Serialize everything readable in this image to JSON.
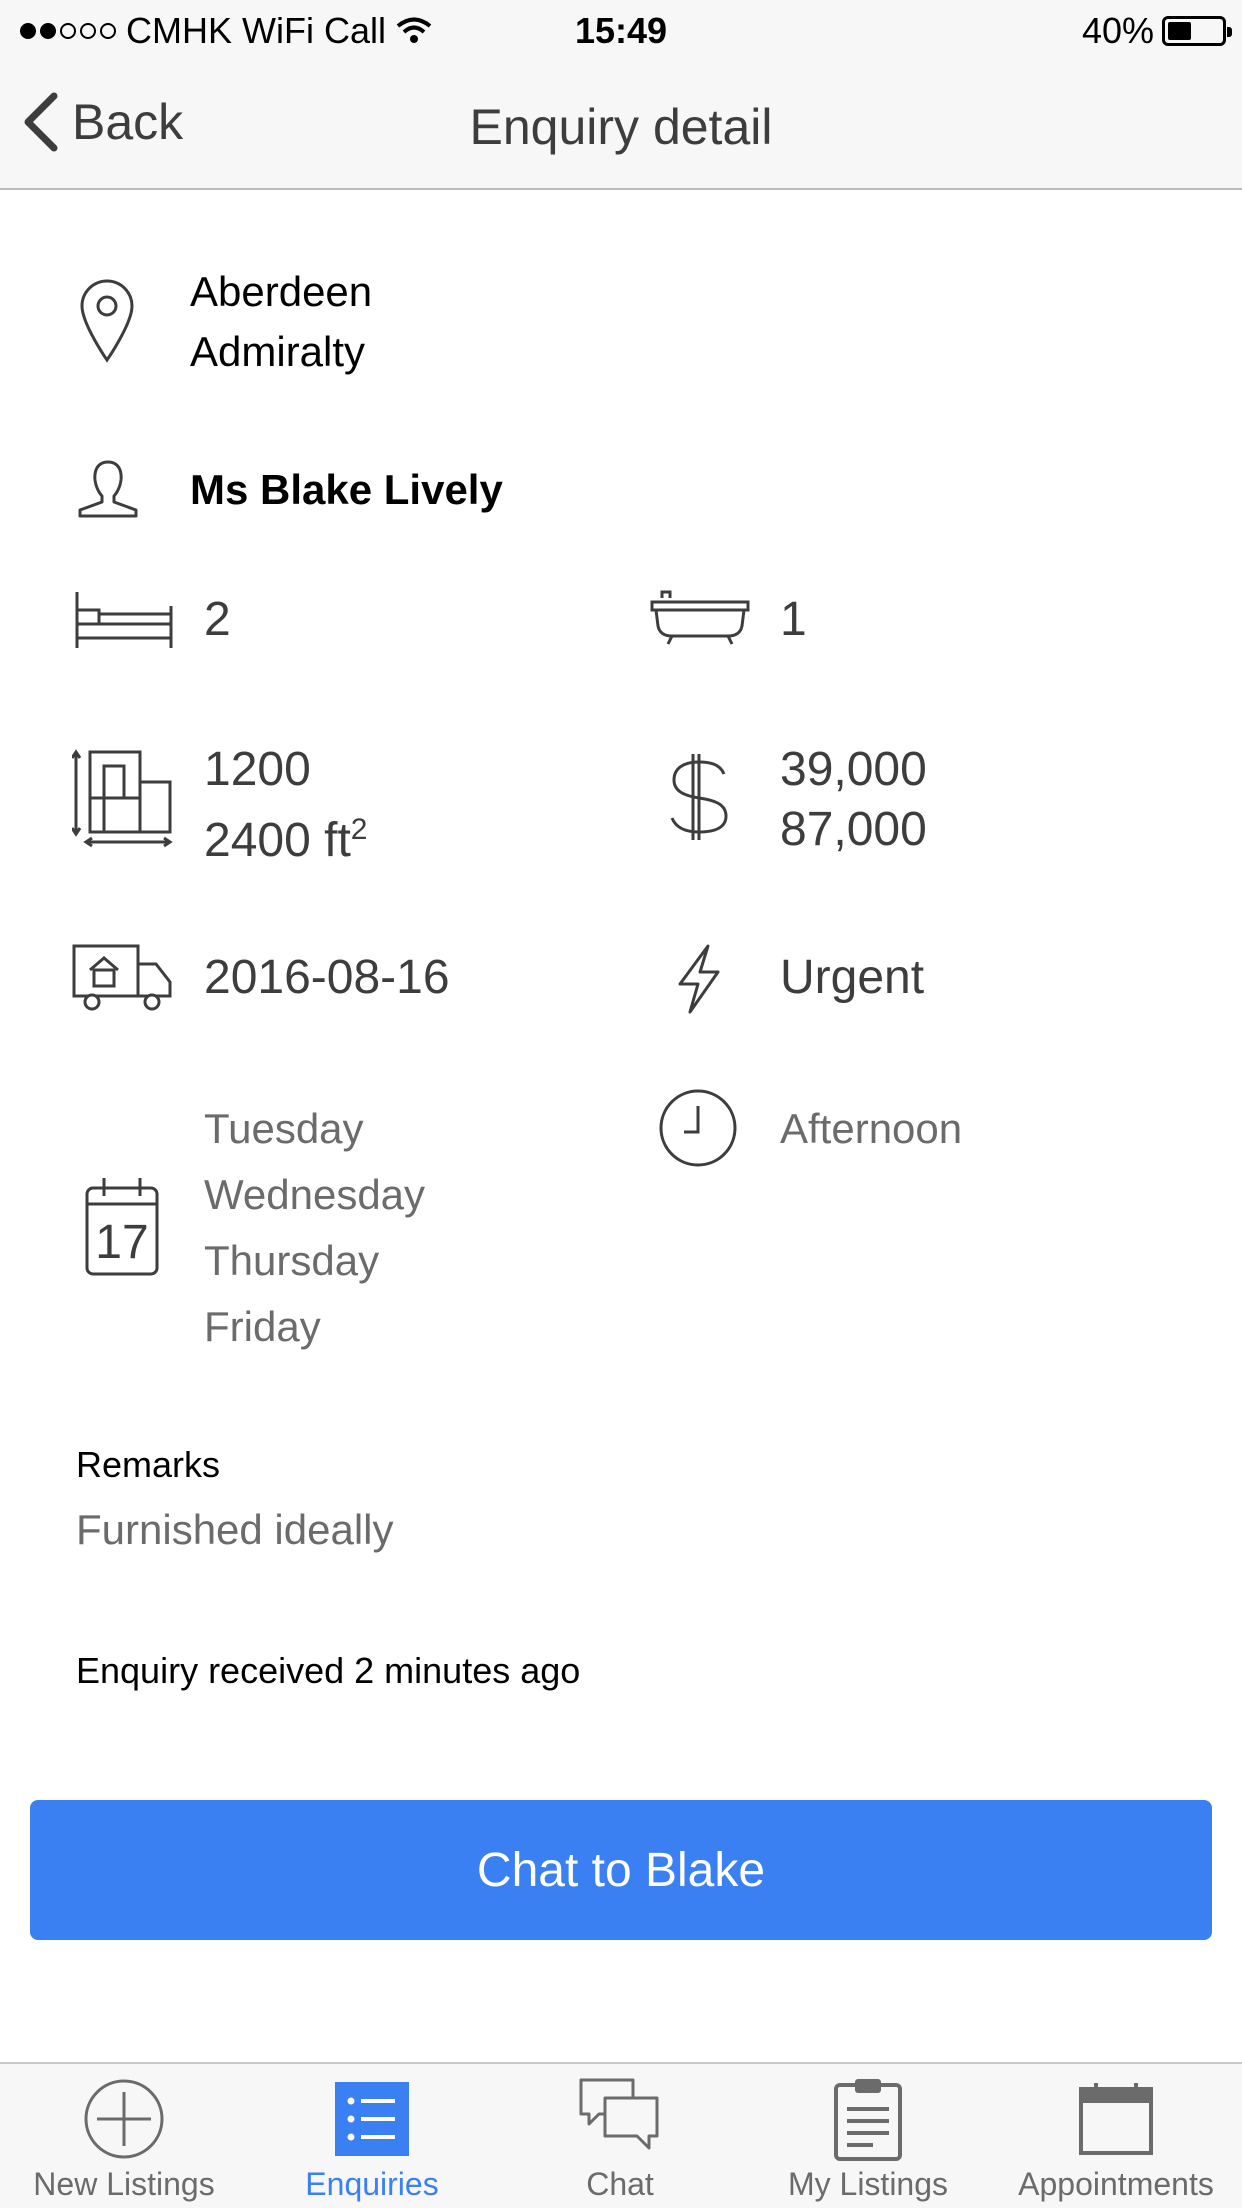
{
  "status_bar": {
    "carrier": "CMHK WiFi Call",
    "time": "15:49",
    "battery": "40%",
    "battery_level": 0.4
  },
  "nav": {
    "back_label": "Back",
    "title": "Enquiry detail"
  },
  "location": {
    "line1": "Aberdeen",
    "line2": "Admiralty"
  },
  "contact": {
    "name": "Ms Blake Lively"
  },
  "bedrooms": "2",
  "bathrooms": "1",
  "size": {
    "min": "1200",
    "max": "2400 ft",
    "unit_sup": "2"
  },
  "price": {
    "min": "39,000",
    "max": "87,000"
  },
  "move_in_date": "2016-08-16",
  "urgency": "Urgent",
  "calendar_day": "17",
  "days": [
    "Tuesday",
    "Wednesday",
    "Thursday",
    "Friday"
  ],
  "time_of_day": "Afternoon",
  "remarks": {
    "title": "Remarks",
    "text": "Furnished ideally"
  },
  "received_text": "Enquiry received 2 minutes ago",
  "chat_button_label": "Chat to Blake",
  "tabs": [
    {
      "label": "New Listings",
      "icon": "plus-circle-icon"
    },
    {
      "label": "Enquiries",
      "icon": "list-icon"
    },
    {
      "label": "Chat",
      "icon": "chat-bubbles-icon"
    },
    {
      "label": "My Listings",
      "icon": "clipboard-icon"
    },
    {
      "label": "Appointments",
      "icon": "calendar-icon"
    }
  ],
  "colors": {
    "accent": "#3b80f2",
    "text_dark": "#3d3d3d",
    "text_light": "#6b6b6b"
  }
}
